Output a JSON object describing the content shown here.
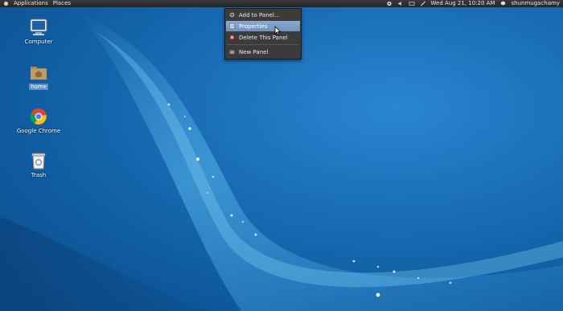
{
  "top_panel": {
    "applications_label": "Applications",
    "places_label": "Places",
    "clock": "Wed Aug 21, 10:20 AM",
    "user_name": "shunmugachamy"
  },
  "desktop_icons": [
    {
      "label": "Computer",
      "icon": "computer-icon"
    },
    {
      "label": "home",
      "icon": "folder-home-icon"
    },
    {
      "label": "Google Chrome",
      "icon": "chrome-icon"
    },
    {
      "label": "Trash",
      "icon": "trash-icon"
    }
  ],
  "context_menu": {
    "items": [
      {
        "label": "Add to Panel...",
        "icon": "add-to-panel-icon"
      },
      {
        "label": "Properties",
        "icon": "properties-icon",
        "highlighted": true
      },
      {
        "label": "Delete This Panel",
        "icon": "delete-panel-icon"
      },
      {
        "label": "New Panel",
        "icon": "new-panel-icon"
      }
    ]
  },
  "colors": {
    "panel_bg": "#2b2b2b",
    "menu_bg": "#3b3b3b",
    "menu_highlight": "#7b9cc6",
    "desktop_blue": "#1a6fb8"
  }
}
